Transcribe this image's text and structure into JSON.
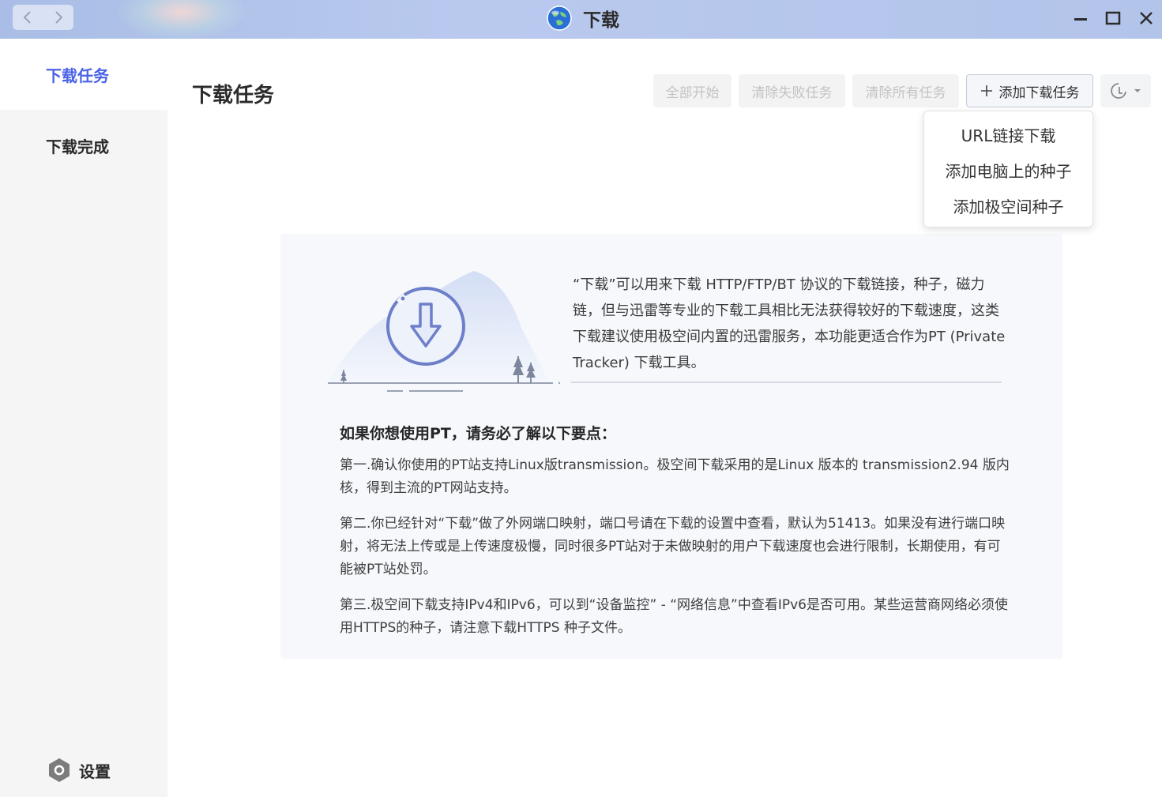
{
  "window": {
    "title": "下载",
    "icons": [
      "back-icon",
      "forward-icon",
      "globe-app-icon",
      "minimize-icon",
      "maximize-icon",
      "close-icon"
    ]
  },
  "sidebar": {
    "items": [
      {
        "label": "下载任务",
        "active": true
      },
      {
        "label": "下载完成",
        "active": false
      }
    ],
    "settings_label": "设置",
    "accent_color": "#4a62e6"
  },
  "main": {
    "title": "下载任务",
    "toolbar": {
      "start_all": "全部开始",
      "clear_failed": "清除失败任务",
      "clear_all": "清除所有任务",
      "add_task": "添加下载任务"
    },
    "add_menu": {
      "items": [
        "URL链接下载",
        "添加电脑上的种子",
        "添加极空间种子"
      ]
    },
    "info": {
      "intro": "“下载”可以用来下载 HTTP/FTP/BT 协议的下载链接，种子，磁力链，但与迅雷等专业的下载工具相比无法获得较好的下载速度，这类下载建议使用极空间内置的迅雷服务，本功能更适合作为PT (Private Tracker) 下载工具。",
      "heading": "如果你想使用PT，请务必了解以下要点：",
      "points": [
        "第一.确认你使用的PT站支持Linux版transmission。极空间下载采用的是Linux 版本的 transmission2.94 版内核，得到主流的PT网站支持。",
        "第二.你已经针对“下载”做了外网端口映射，端口号请在下载的设置中查看，默认为51413。如果没有进行端口映射，将无法上传或是上传速度极慢，同时很多PT站对于未做映射的用户下载速度也会进行限制，长期使用，有可能被PT站处罚。",
        "第三.极空间下载支持IPv4和IPv6，可以到“设备监控” - “网络信息”中查看IPv6是否可用。某些运营商网络必须使用HTTPS的种子，请注意下载HTTPS 种子文件。"
      ]
    }
  }
}
